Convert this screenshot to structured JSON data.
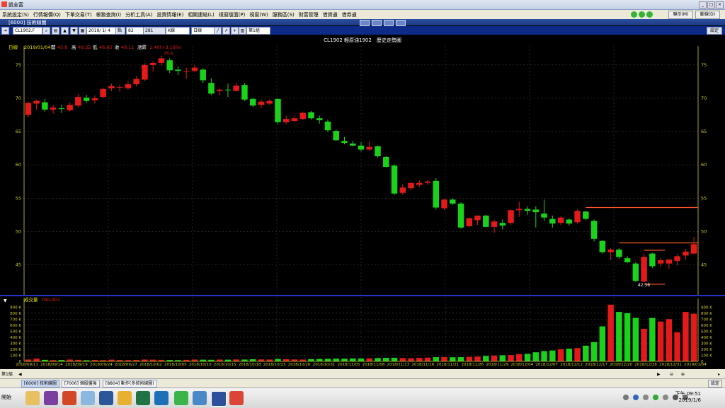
{
  "window": {
    "title": "凱全富",
    "app_icon": "app-icon"
  },
  "menu": {
    "items": [
      "系統設定(S)",
      "行情報價(Q)",
      "下單交易(T)",
      "帳務查詢(I)",
      "分析工具(A)",
      "投資情報(E)",
      "相關連結(L)",
      "視窗版面(P)",
      "視窗(W)",
      "服務區(S)",
      "財富管理",
      "借貸通",
      "借券通"
    ],
    "right_buttons": [
      "聯示(M)",
      "斷線(D)"
    ]
  },
  "subwindow": {
    "title": "[6000] 技術線圖"
  },
  "toolbar": {
    "symbol": "CL1902.F",
    "date": "2019/ 1/ 4",
    "count_label": "點",
    "count": "82",
    "total": "281",
    "kline_select": "K線",
    "period_select": "日線",
    "page_select": "第1組",
    "settings": "設定"
  },
  "colors": {
    "up": "#e41a1a",
    "down": "#1ad21a",
    "background": "#000000",
    "axis": "#cccc33",
    "grid": "#3a3a3a",
    "divider": "#2633c8"
  },
  "chart_data": [
    {
      "type": "candlestick",
      "title": "CL1902 輕原油1902　歷史走勢圖",
      "info_line": {
        "label": "日線",
        "date": "2019/01/04",
        "open_label": "開",
        "open": "45.9",
        "high_label": "高",
        "high": "49.22",
        "low_label": "低",
        "low": "46.65",
        "close_label": "收",
        "close": "48.11",
        "change_label": "漲跌",
        "change": "1.40(+3.16%)"
      },
      "ylim": [
        40.5,
        77
      ],
      "yticks": [
        45,
        50,
        55,
        60,
        65,
        70,
        75
      ],
      "annotations": {
        "high_mark": "76.4",
        "low_mark": "42.36"
      },
      "candles": [
        {
          "o": 67.5,
          "h": 69.5,
          "l": 67.1,
          "c": 69.3
        },
        {
          "o": 69.2,
          "h": 69.8,
          "l": 68.3,
          "c": 69.6
        },
        {
          "o": 69.4,
          "h": 69.9,
          "l": 68.0,
          "c": 68.3
        },
        {
          "o": 68.3,
          "h": 69.0,
          "l": 67.7,
          "c": 68.6
        },
        {
          "o": 68.5,
          "h": 69.0,
          "l": 67.8,
          "c": 68.4
        },
        {
          "o": 68.2,
          "h": 69.4,
          "l": 68.0,
          "c": 69.0
        },
        {
          "o": 68.9,
          "h": 70.6,
          "l": 68.7,
          "c": 70.2
        },
        {
          "o": 70.1,
          "h": 70.5,
          "l": 69.3,
          "c": 69.6
        },
        {
          "o": 69.7,
          "h": 70.4,
          "l": 69.2,
          "c": 70.0
        },
        {
          "o": 70.2,
          "h": 71.6,
          "l": 70.0,
          "c": 71.4
        },
        {
          "o": 71.5,
          "h": 72.2,
          "l": 71.1,
          "c": 71.8
        },
        {
          "o": 71.6,
          "h": 72.0,
          "l": 71.0,
          "c": 71.7
        },
        {
          "o": 71.5,
          "h": 72.6,
          "l": 71.3,
          "c": 72.1
        },
        {
          "o": 72.1,
          "h": 73.3,
          "l": 71.8,
          "c": 72.9
        },
        {
          "o": 72.8,
          "h": 75.2,
          "l": 72.6,
          "c": 75.0
        },
        {
          "o": 75.0,
          "h": 75.6,
          "l": 74.0,
          "c": 75.3
        },
        {
          "o": 75.3,
          "h": 76.4,
          "l": 74.9,
          "c": 76.0
        },
        {
          "o": 75.7,
          "h": 76.0,
          "l": 73.8,
          "c": 74.2
        },
        {
          "o": 74.3,
          "h": 74.8,
          "l": 73.5,
          "c": 74.1
        },
        {
          "o": 74.0,
          "h": 74.6,
          "l": 72.9,
          "c": 74.1
        },
        {
          "o": 74.1,
          "h": 75.0,
          "l": 73.9,
          "c": 74.6
        },
        {
          "o": 74.3,
          "h": 74.5,
          "l": 72.3,
          "c": 72.7
        },
        {
          "o": 72.3,
          "h": 73.0,
          "l": 70.5,
          "c": 70.7
        },
        {
          "o": 71.1,
          "h": 71.4,
          "l": 70.4,
          "c": 71.3
        },
        {
          "o": 71.3,
          "h": 72.2,
          "l": 70.2,
          "c": 71.2
        },
        {
          "o": 71.1,
          "h": 72.3,
          "l": 71.0,
          "c": 71.9
        },
        {
          "o": 72.0,
          "h": 72.3,
          "l": 69.6,
          "c": 69.8
        },
        {
          "o": 69.9,
          "h": 70.1,
          "l": 68.7,
          "c": 68.9
        },
        {
          "o": 69.0,
          "h": 69.8,
          "l": 68.5,
          "c": 69.5
        },
        {
          "o": 69.2,
          "h": 69.8,
          "l": 69.0,
          "c": 69.6
        },
        {
          "o": 69.9,
          "h": 70.0,
          "l": 66.1,
          "c": 66.4
        },
        {
          "o": 66.4,
          "h": 67.4,
          "l": 66.1,
          "c": 66.9
        },
        {
          "o": 66.6,
          "h": 67.3,
          "l": 66.4,
          "c": 67.0
        },
        {
          "o": 66.9,
          "h": 68.0,
          "l": 66.7,
          "c": 67.8
        },
        {
          "o": 67.9,
          "h": 68.1,
          "l": 66.8,
          "c": 67.0
        },
        {
          "o": 67.0,
          "h": 67.4,
          "l": 66.2,
          "c": 66.7
        },
        {
          "o": 66.5,
          "h": 66.8,
          "l": 64.9,
          "c": 65.2
        },
        {
          "o": 65.1,
          "h": 65.3,
          "l": 63.6,
          "c": 63.7
        },
        {
          "o": 63.6,
          "h": 64.2,
          "l": 63.1,
          "c": 63.3
        },
        {
          "o": 63.2,
          "h": 63.6,
          "l": 62.8,
          "c": 62.9
        },
        {
          "o": 62.9,
          "h": 63.4,
          "l": 62.0,
          "c": 62.3
        },
        {
          "o": 62.3,
          "h": 63.5,
          "l": 62.1,
          "c": 62.7
        },
        {
          "o": 62.8,
          "h": 62.9,
          "l": 61.1,
          "c": 61.3
        },
        {
          "o": 61.2,
          "h": 61.3,
          "l": 59.6,
          "c": 59.7
        },
        {
          "o": 59.9,
          "h": 60.1,
          "l": 55.5,
          "c": 55.7
        },
        {
          "o": 55.8,
          "h": 57.1,
          "l": 55.5,
          "c": 56.6
        },
        {
          "o": 56.5,
          "h": 57.3,
          "l": 56.2,
          "c": 57.3
        },
        {
          "o": 57.0,
          "h": 57.7,
          "l": 56.7,
          "c": 57.3
        },
        {
          "o": 57.3,
          "h": 57.8,
          "l": 57.0,
          "c": 57.5
        },
        {
          "o": 57.6,
          "h": 58.0,
          "l": 53.3,
          "c": 53.6
        },
        {
          "o": 53.5,
          "h": 54.9,
          "l": 53.2,
          "c": 54.8
        },
        {
          "o": 54.8,
          "h": 55.0,
          "l": 54.0,
          "c": 54.2
        },
        {
          "o": 54.2,
          "h": 54.4,
          "l": 50.4,
          "c": 50.6
        },
        {
          "o": 50.8,
          "h": 52.1,
          "l": 50.7,
          "c": 52.0
        },
        {
          "o": 51.7,
          "h": 52.3,
          "l": 51.0,
          "c": 52.4
        },
        {
          "o": 52.4,
          "h": 52.5,
          "l": 50.6,
          "c": 50.7
        },
        {
          "o": 50.7,
          "h": 51.8,
          "l": 49.8,
          "c": 51.5
        },
        {
          "o": 51.3,
          "h": 51.8,
          "l": 50.3,
          "c": 50.9
        },
        {
          "o": 51.3,
          "h": 53.3,
          "l": 51.0,
          "c": 53.2
        },
        {
          "o": 53.2,
          "h": 54.5,
          "l": 52.2,
          "c": 53.4
        },
        {
          "o": 53.4,
          "h": 53.8,
          "l": 52.5,
          "c": 53.1
        },
        {
          "o": 53.3,
          "h": 53.8,
          "l": 50.6,
          "c": 52.9
        },
        {
          "o": 52.7,
          "h": 54.8,
          "l": 51.6,
          "c": 52.1
        },
        {
          "o": 51.9,
          "h": 52.4,
          "l": 50.6,
          "c": 51.2
        },
        {
          "o": 51.3,
          "h": 52.3,
          "l": 51.0,
          "c": 52.1
        },
        {
          "o": 51.8,
          "h": 52.0,
          "l": 50.9,
          "c": 51.2
        },
        {
          "o": 51.4,
          "h": 53.3,
          "l": 51.2,
          "c": 53.1
        },
        {
          "o": 53.0,
          "h": 53.1,
          "l": 51.7,
          "c": 51.9
        },
        {
          "o": 51.6,
          "h": 51.8,
          "l": 48.5,
          "c": 48.9
        },
        {
          "o": 48.6,
          "h": 48.7,
          "l": 46.7,
          "c": 46.9
        },
        {
          "o": 46.9,
          "h": 47.5,
          "l": 45.7,
          "c": 47.3
        },
        {
          "o": 47.3,
          "h": 47.5,
          "l": 45.9,
          "c": 46.2
        },
        {
          "o": 46.0,
          "h": 46.3,
          "l": 45.3,
          "c": 45.4
        },
        {
          "o": 45.2,
          "h": 45.4,
          "l": 42.4,
          "c": 42.6
        },
        {
          "o": 42.5,
          "h": 46.7,
          "l": 42.4,
          "c": 46.2
        },
        {
          "o": 46.7,
          "h": 46.8,
          "l": 44.5,
          "c": 44.8
        },
        {
          "o": 45.2,
          "h": 46.0,
          "l": 44.7,
          "c": 45.7
        },
        {
          "o": 45.2,
          "h": 45.8,
          "l": 44.4,
          "c": 45.8
        },
        {
          "o": 45.6,
          "h": 46.6,
          "l": 44.9,
          "c": 46.3
        },
        {
          "o": 46.4,
          "h": 47.4,
          "l": 45.8,
          "c": 47.0
        },
        {
          "o": 46.7,
          "h": 49.2,
          "l": 46.6,
          "c": 48.1
        }
      ],
      "resistance_lines": [
        {
          "start_index": 67,
          "end_index": 80,
          "value": 53.6
        },
        {
          "start_index": 71,
          "end_index": 80,
          "value": 48.3
        },
        {
          "start_index": 74,
          "end_index": 76,
          "value": 47.2
        },
        {
          "start_index": 74,
          "end_index": 76,
          "value": 42.1
        }
      ],
      "x_tick_labels": [
        "2018/09/11",
        "2018/09/14",
        "2018/09/19",
        "2018/09/24",
        "2018/09/27",
        "2018/10/02",
        "2018/10/05",
        "2018/10/10",
        "2018/10/15",
        "2018/10/18",
        "2018/10/23",
        "2018/10/26",
        "2018/10/31",
        "2018/11/05",
        "2018/11/08",
        "2018/11/13",
        "2018/11/16",
        "2018/11/21",
        "2018/11/26",
        "2018/11/29",
        "2018/12/04",
        "2018/12/07",
        "2018/12/12",
        "2018/12/17",
        "2018/12/20",
        "2018/12/26",
        "2018/12/31",
        "2019/01/04"
      ]
    },
    {
      "type": "bar",
      "title": "成交量",
      "value_label": "790,007",
      "ylim": [
        0,
        950000
      ],
      "yticks": [
        0,
        100000,
        200000,
        300000,
        400000,
        500000,
        600000,
        700000,
        800000,
        900000
      ],
      "ytick_labels": [
        "0",
        "100 K",
        "200 K",
        "300 K",
        "400 K",
        "500 K",
        "600 K",
        "700 K",
        "800 K",
        "900 K"
      ],
      "values": [
        30000,
        45000,
        25000,
        20000,
        22000,
        30000,
        25000,
        18000,
        22000,
        20000,
        28000,
        22000,
        20000,
        24000,
        30000,
        28000,
        25000,
        22000,
        20000,
        25000,
        30000,
        28000,
        26000,
        30000,
        28000,
        32000,
        30000,
        35000,
        32000,
        30000,
        40000,
        35000,
        32000,
        30000,
        36000,
        40000,
        42000,
        45000,
        44000,
        48000,
        46000,
        50000,
        55000,
        58000,
        60000,
        55000,
        52000,
        58000,
        62000,
        70000,
        72000,
        68000,
        70000,
        75000,
        80000,
        90000,
        95000,
        100000,
        105000,
        120000,
        125000,
        150000,
        170000,
        180000,
        200000,
        210000,
        220000,
        260000,
        320000,
        580000,
        940000,
        820000,
        800000,
        720000,
        540000,
        720000,
        660000,
        700000,
        480000,
        820000,
        790000
      ]
    }
  ],
  "tabs": {
    "items": [
      "[6000] 技術線圖",
      "[7006] 個股盤後",
      "[8804] 動作(多技術線圖)"
    ],
    "settings": "設定",
    "group": "第1組"
  },
  "taskbar": {
    "start": "開始",
    "time": "下午 09:51",
    "date": "2019/1/6",
    "apps": [
      "folder-icon",
      "onenote-icon",
      "powerpoint-icon",
      "paint-icon",
      "word-icon",
      "chrome-icon",
      "excel-icon",
      "writer-icon",
      "line-icon",
      "wave-icon",
      "trading-app-icon",
      "chrome2-icon"
    ]
  }
}
